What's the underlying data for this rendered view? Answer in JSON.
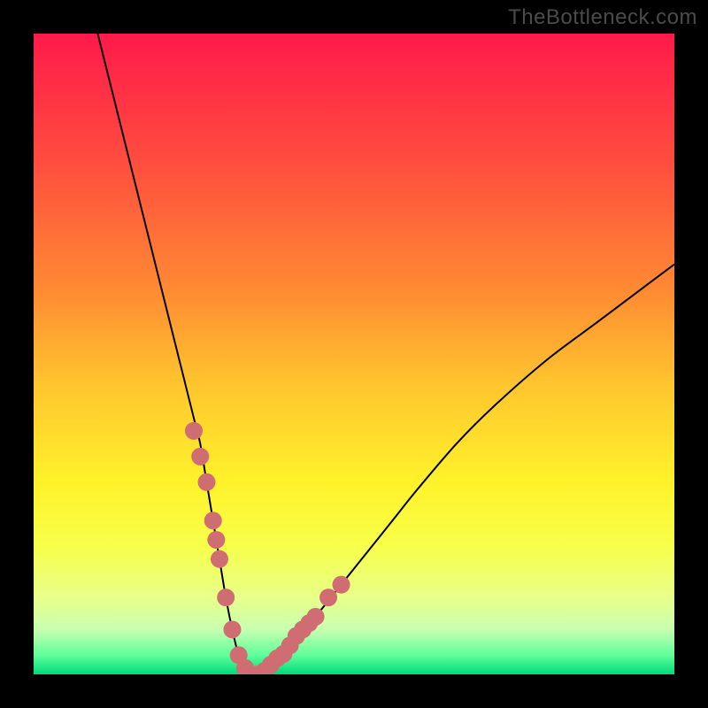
{
  "watermark": {
    "text": "TheBottleneck.com"
  },
  "colors": {
    "outer_bg": "#000000",
    "watermark": "#4b4b4b",
    "curve": "#000000",
    "markers": "#cf6d72",
    "gradient_stops": [
      {
        "offset": 0.0,
        "color": "#ff1a4a"
      },
      {
        "offset": 0.2,
        "color": "#ff4d3f"
      },
      {
        "offset": 0.4,
        "color": "#ff8a33"
      },
      {
        "offset": 0.55,
        "color": "#ffc62e"
      },
      {
        "offset": 0.7,
        "color": "#fff22a"
      },
      {
        "offset": 0.8,
        "color": "#f7ff4a"
      },
      {
        "offset": 0.88,
        "color": "#e8ff8a"
      },
      {
        "offset": 0.93,
        "color": "#c8ffb0"
      },
      {
        "offset": 0.97,
        "color": "#5fff9a"
      },
      {
        "offset": 1.0,
        "color": "#00d97a"
      }
    ]
  },
  "chart_data": {
    "type": "line",
    "title": "",
    "xlabel": "",
    "ylabel": "",
    "xlim": [
      0,
      100
    ],
    "ylim": [
      0,
      100
    ],
    "series": [
      {
        "name": "bottleneck-curve",
        "x": [
          10,
          12,
          14,
          16,
          18,
          20,
          22,
          24,
          25,
          26,
          27,
          28,
          29,
          30,
          31,
          32,
          33,
          34,
          35,
          37,
          40,
          44,
          48,
          52,
          56,
          60,
          66,
          72,
          80,
          88,
          96,
          100
        ],
        "y": [
          100,
          92,
          84,
          76,
          68,
          60,
          52,
          44,
          40,
          36,
          30,
          24,
          18,
          12,
          7,
          3,
          1,
          0,
          0,
          1,
          4,
          9,
          14,
          19,
          24,
          29,
          36,
          42,
          49,
          55,
          61,
          64
        ]
      }
    ],
    "markers": {
      "name": "highlighted-points",
      "x": [
        25.0,
        26.0,
        27.0,
        28.0,
        28.5,
        29.0,
        30.0,
        31.0,
        32.0,
        33.0,
        34.0,
        35.0,
        36.0,
        37.0,
        38.0,
        39.0,
        40.0,
        41.0,
        42.0,
        43.0,
        44.0,
        46.0,
        48.0
      ],
      "y": [
        38,
        34,
        30,
        24,
        21,
        18,
        12,
        7,
        3,
        1,
        0,
        0,
        0.5,
        1.5,
        2.5,
        3.2,
        4.5,
        6,
        7,
        8,
        9,
        12,
        14
      ]
    }
  }
}
